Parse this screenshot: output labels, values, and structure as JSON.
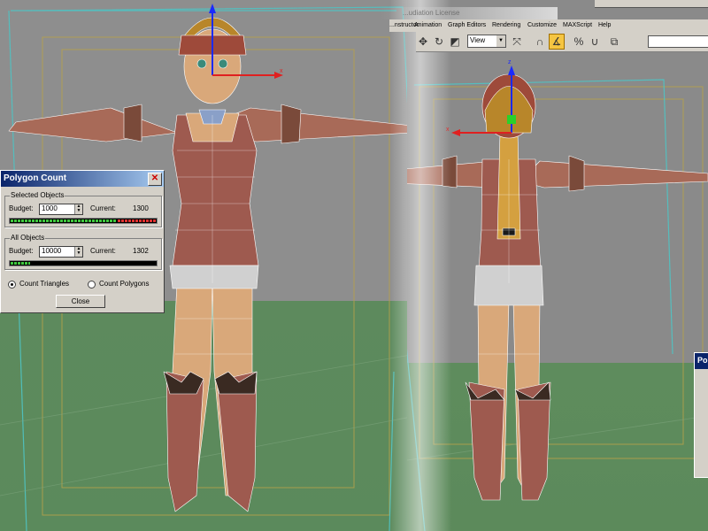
{
  "window": {
    "title_fragment": "...udiation License"
  },
  "menu": [
    "...nstructor",
    "Animation",
    "Graph Editors",
    "Rendering",
    "Customize",
    "MAXScript",
    "Help"
  ],
  "toolbar": {
    "view_select": "View",
    "icons": [
      "select-move-icon",
      "rotate-icon",
      "scale-icon",
      "view-dropdown-icon",
      "mirror-icon",
      "snap-3-icon",
      "angle-snap-icon",
      "percent-snap-icon",
      "spinner-snap-icon",
      "edit-named-selections-icon"
    ],
    "active_tool": "angle-snap-icon"
  },
  "viewports": {
    "left": {
      "name": "front-viewport"
    },
    "right": {
      "name": "back-viewport",
      "gizmo_axis_x": "x",
      "gizmo_axis_z": "z"
    },
    "left_gizmo_axis": "x"
  },
  "polygon_count": {
    "title": "Polygon Count",
    "selected": {
      "group_label": "Selected Objects",
      "budget_label": "Budget:",
      "budget_value": "1000",
      "current_label": "Current:",
      "current_value": "1300",
      "meter_fill": 1.0
    },
    "all": {
      "group_label": "All Objects",
      "budget_label": "Budget:",
      "budget_value": "10000",
      "current_label": "Current:",
      "current_value": "1302",
      "meter_fill": 0.13
    },
    "options": [
      "Count Triangles",
      "Count Polygons"
    ],
    "selected_option": "Count Triangles",
    "close_label": "Close"
  },
  "second_dialog": {
    "title_fragment": "Po"
  },
  "colors": {
    "titlebar": "#0a246a",
    "dialog_face": "#d4d0c8",
    "meter_green": "#3ec83e",
    "meter_red": "#e03030",
    "ground": "#5d8a5d",
    "viewport_bg": "#8e8e8e",
    "mesh_wire": "#ffffff",
    "skin": "#d9a87a",
    "outfit": "#9e5a4f",
    "hair": "#d4a040",
    "selection_box": "#4fc3c3"
  }
}
